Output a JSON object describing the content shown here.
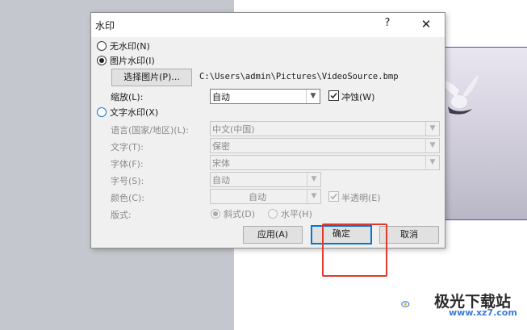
{
  "dialog": {
    "title": "水印",
    "help_glyph": "?",
    "close_glyph": "✕"
  },
  "options": {
    "no_watermark": "无水印(N)",
    "picture_watermark": "图片水印(I)",
    "select_picture_button": "选择图片(P)...",
    "picture_path": "C:\\Users\\admin\\Pictures\\VideoSource.bmp",
    "scale_label": "缩放(L):",
    "scale_value": "自动",
    "washout_label": "冲蚀(W)",
    "washout_checked": true,
    "text_watermark": "文字水印(X)",
    "language_label": "语言(国家/地区)(L):",
    "language_value": "中文(中国)",
    "text_label": "文字(T):",
    "text_value": "保密",
    "font_label": "字体(F):",
    "font_value": "宋体",
    "size_label": "字号(S):",
    "size_value": "自动",
    "color_label": "颜色(C):",
    "color_value": "自动",
    "semitransparent_label": "半透明(E)",
    "semitransparent_checked": true,
    "layout_label": "版式:",
    "diagonal_label": "斜式(D)",
    "horizontal_label": "水平(H)"
  },
  "buttons": {
    "apply": "应用(A)",
    "ok": "确定",
    "cancel": "取消"
  },
  "watermark_logo": {
    "text": "极光下载站",
    "url": "www.xz7.com"
  },
  "colors": {
    "highlight": "#e03a2f",
    "accent": "#0078d7"
  }
}
